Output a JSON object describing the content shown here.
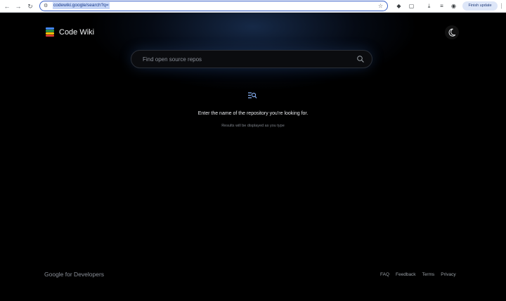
{
  "browser": {
    "url": "codewiki.google/search?q=",
    "finish_update_label": "Finish update"
  },
  "header": {
    "brand": "Code Wiki"
  },
  "search": {
    "placeholder": "Find open source repos"
  },
  "empty_state": {
    "title": "Enter the name of the repository you're looking for.",
    "subtitle": "Results will be displayed as you type"
  },
  "footer": {
    "logo_text": "Google for Developers",
    "links": [
      {
        "label": "FAQ"
      },
      {
        "label": "Feedback"
      },
      {
        "label": "Terms"
      },
      {
        "label": "Privacy"
      }
    ]
  },
  "colors": {
    "background": "#000000",
    "accent": "#8ab4f8",
    "text": "#e8eaed",
    "muted": "#7d828a"
  },
  "icons": [
    "back-icon",
    "forward-icon",
    "reload-icon",
    "site-info-icon",
    "star-icon",
    "extension-icon",
    "puzzle-icon",
    "download-icon",
    "profile-icon",
    "menu-icon",
    "code-wiki-logo",
    "moon-icon",
    "search-icon",
    "search-list-icon"
  ]
}
